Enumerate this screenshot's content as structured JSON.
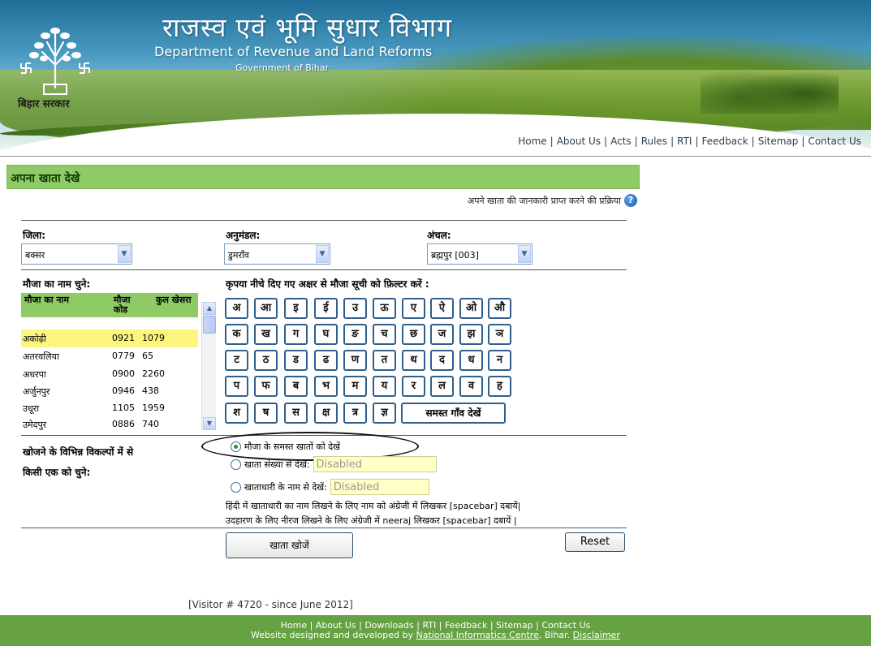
{
  "header": {
    "title_hi": "राजस्व एवं भूमि सुधार विभाग",
    "title_en": "Department of Revenue and Land Reforms",
    "subtitle_en": "Government of Bihar",
    "state_label": "बिहार सरकार",
    "emblem_icon": "bihar-bodhi-tree-emblem",
    "nav": [
      "Home",
      "About Us",
      "Acts",
      "Rules",
      "RTI",
      "Feedback",
      "Sitemap",
      "Contact Us"
    ]
  },
  "page": {
    "section_title": "अपना खाता देखे",
    "help_text": "अपने खाता की जानकारी प्राप्त करने की प्रक्रिया",
    "help_icon": "question-help-icon"
  },
  "selects": {
    "district_label": "जिला:",
    "district_value": "बक्सर",
    "subdivision_label": "अनुमंडल:",
    "subdivision_value": "डुमराँव",
    "circle_label": "अंचल:",
    "circle_value": "ब्रह्मपुर [003]"
  },
  "mauza": {
    "label": "मौजा का नाम चुने:",
    "headers": [
      "मौजा का नाम",
      "मौजा कोड",
      "कुल खेसरा"
    ],
    "rows": [
      {
        "name": "अकोढ़ी",
        "code": "0921",
        "khesra": "1079",
        "selected": true
      },
      {
        "name": "अतरवलिया",
        "code": "0779",
        "khesra": "65"
      },
      {
        "name": "अधरपा",
        "code": "0900",
        "khesra": "2260"
      },
      {
        "name": "अर्जुनपुर",
        "code": "0946",
        "khesra": "438"
      },
      {
        "name": "उधूरा",
        "code": "1105",
        "khesra": "1959"
      },
      {
        "name": "उमेदपुर",
        "code": "0886",
        "khesra": "740"
      }
    ]
  },
  "filter": {
    "label": "कृपया नीचे दिए गए अक्षर से मौजा सूची को फ़िल्टर करें :",
    "letters_row1": [
      "अ",
      "आ",
      "इ",
      "ई",
      "उ",
      "ऊ",
      "ए",
      "ऐ",
      "ओ",
      "औ"
    ],
    "letters_row2": [
      "क",
      "ख",
      "ग",
      "घ",
      "ङ",
      "च",
      "छ",
      "ज",
      "झ",
      "ञ"
    ],
    "letters_row3": [
      "ट",
      "ठ",
      "ड",
      "ढ",
      "ण",
      "त",
      "थ",
      "द",
      "ध",
      "न"
    ],
    "letters_row4": [
      "प",
      "फ",
      "ब",
      "भ",
      "म",
      "य",
      "र",
      "ल",
      "व",
      "ह"
    ],
    "letters_row5": [
      "श",
      "ष",
      "स",
      "क्ष",
      "त्र",
      "ज्ञ"
    ],
    "all_villages": "समस्त गाँव देखें"
  },
  "search_options": {
    "label_line1": "खोजने के विभिन्न विकल्पों में से",
    "label_line2": "किसी एक को चुने:",
    "opt_all": "मौजा के समस्त खातों को देखें",
    "opt_account": "खाता संख्या से देखें:",
    "opt_account_value": "Disabled",
    "opt_owner": "खाताधारी के नाम से देखें:",
    "opt_owner_value": "Disabled",
    "note1": "हिंदी में खाताधारी का नाम लिखने के लिए नाम को अंग्रेजी में लिखकर [spacebar] दबायें|",
    "note2": "उदहारण के लिए नीरज लिखने के लिए अंग्रेजी में neeraj लिखकर [spacebar] दबायें |"
  },
  "buttons": {
    "search": "खाता खोजें",
    "reset": "Reset"
  },
  "visitor": "[Visitor # 4720  - since June 2012]",
  "footer": {
    "links": [
      "Home",
      "About Us",
      "Downloads",
      "RTI",
      "Feedback",
      "Sitemap",
      "Contact Us"
    ],
    "credit_prefix": "Website designed and developed by",
    "credit_org": "National Informatics Centre",
    "credit_suffix": ", Bihar.",
    "disclaimer": "Disclaimer"
  },
  "colors": {
    "header_band": "#8ecb67",
    "footer_bg": "#66a143",
    "selected_row": "#fcf57e",
    "disabled_input_bg": "#ffffc6"
  }
}
